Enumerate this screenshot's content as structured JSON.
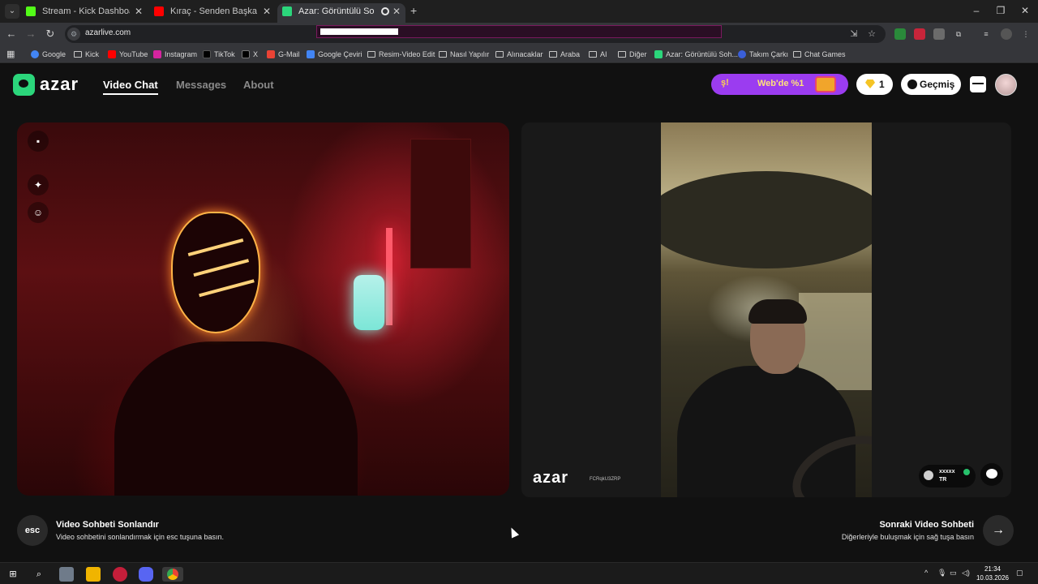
{
  "browser": {
    "tabs": [
      {
        "title": "Stream - Kick Dashboard",
        "favicon_color": "#53fc18"
      },
      {
        "title": "Kıraç - Senden Başka (Official V",
        "favicon_color": "#ff0000"
      },
      {
        "title": "Azar: Görüntülü Sohbet & V",
        "favicon_color": "#2bd67b"
      }
    ],
    "new_tab_label": "+",
    "url": "azarlive.com",
    "bookmarks": [
      {
        "label": "Google",
        "icon": "google-icon"
      },
      {
        "label": "Kick",
        "icon": "folder-icon"
      },
      {
        "label": "YouTube",
        "icon": "youtube-icon"
      },
      {
        "label": "Instagram",
        "icon": "instagram-icon"
      },
      {
        "label": "TikTok",
        "icon": "tiktok-icon"
      },
      {
        "label": "X",
        "icon": "x-icon"
      },
      {
        "label": "G-Mail",
        "icon": "gmail-icon"
      },
      {
        "label": "Google Çeviri",
        "icon": "translate-icon"
      },
      {
        "label": "Resim-Video Edit",
        "icon": "folder-icon"
      },
      {
        "label": "Nasıl Yapılır",
        "icon": "folder-icon"
      },
      {
        "label": "Alınacaklar",
        "icon": "folder-icon"
      },
      {
        "label": "Araba",
        "icon": "folder-icon"
      },
      {
        "label": "AI",
        "icon": "folder-icon"
      },
      {
        "label": "Diğer",
        "icon": "folder-icon"
      },
      {
        "label": "Azar: Görüntülü Soh...",
        "icon": "azar-icon"
      },
      {
        "label": "Takım Çarkı",
        "icon": "wheel-icon"
      },
      {
        "label": "Chat Games",
        "icon": "folder-icon"
      }
    ]
  },
  "header": {
    "logo_text": "azar",
    "nav": [
      {
        "label": "Video Chat",
        "active": true
      },
      {
        "label": "Messages",
        "active": false
      },
      {
        "label": "About",
        "active": false
      }
    ],
    "promo_icon": "ş!",
    "promo_text": "Web'de %1",
    "gem_count": "1",
    "history_label": "Geçmiş"
  },
  "remote": {
    "watermark": "azar",
    "session_code": "FCRqkU3ZRP",
    "peer_name": "xxxxx",
    "peer_country": "TR"
  },
  "controls": {
    "esc_label": "esc",
    "end_title": "Video Sohbeti Sonlandır",
    "end_desc": "Video sohbetini sonlandırmak için esc tuşuna basın.",
    "next_title": "Sonraki Video Sohbeti",
    "next_desc": "Diğerleriyle buluşmak için sağ tuşa basın",
    "next_icon": "→"
  },
  "taskbar": {
    "time": "21:34",
    "date": "10.03.2026"
  },
  "colors": {
    "accent_green": "#2bd67b",
    "promo_purple": "#9b3cf0",
    "background": "#111111"
  }
}
